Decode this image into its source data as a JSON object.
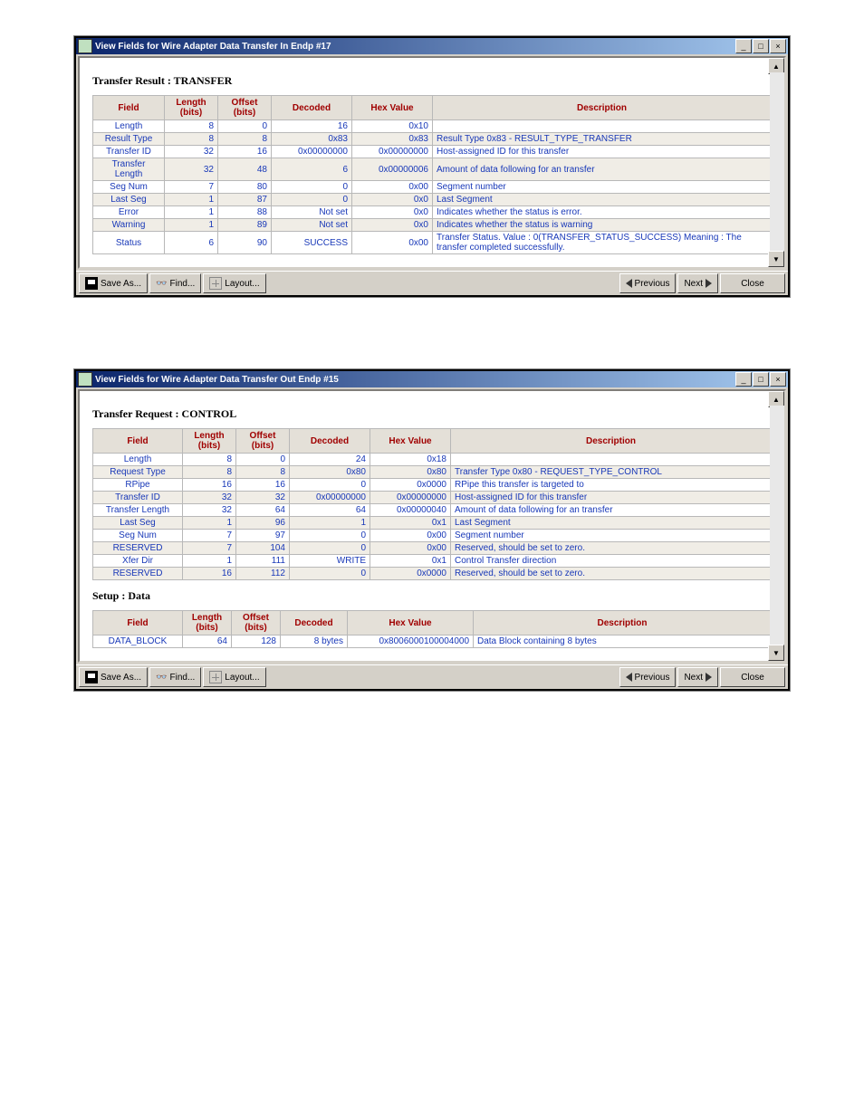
{
  "window1": {
    "title": "View Fields for Wire Adapter Data Transfer In Endp #17",
    "heading": "Transfer Result : TRANSFER",
    "columns": [
      "Field",
      "Length (bits)",
      "Offset (bits)",
      "Decoded",
      "Hex Value",
      "Description"
    ],
    "rows": [
      {
        "field": "Length",
        "length": "8",
        "offset": "0",
        "decoded": "16",
        "hex": "0x10",
        "desc": ""
      },
      {
        "field": "Result Type",
        "length": "8",
        "offset": "8",
        "decoded": "0x83",
        "hex": "0x83",
        "desc": "Result Type 0x83 - RESULT_TYPE_TRANSFER"
      },
      {
        "field": "Transfer ID",
        "length": "32",
        "offset": "16",
        "decoded": "0x00000000",
        "hex": "0x00000000",
        "desc": "Host-assigned ID for this transfer"
      },
      {
        "field": "Transfer Length",
        "length": "32",
        "offset": "48",
        "decoded": "6",
        "hex": "0x00000006",
        "desc": "Amount of data following for an transfer"
      },
      {
        "field": "Seg Num",
        "length": "7",
        "offset": "80",
        "decoded": "0",
        "hex": "0x00",
        "desc": "Segment number"
      },
      {
        "field": "Last Seg",
        "length": "1",
        "offset": "87",
        "decoded": "0",
        "hex": "0x0",
        "desc": "Last Segment"
      },
      {
        "field": "Error",
        "length": "1",
        "offset": "88",
        "decoded": "Not set",
        "hex": "0x0",
        "desc": "Indicates whether the status is error."
      },
      {
        "field": "Warning",
        "length": "1",
        "offset": "89",
        "decoded": "Not set",
        "hex": "0x0",
        "desc": "Indicates whether the status is warning"
      },
      {
        "field": "Status",
        "length": "6",
        "offset": "90",
        "decoded": "SUCCESS",
        "hex": "0x00",
        "desc": "Transfer Status. Value : 0(TRANSFER_STATUS_SUCCESS) Meaning : The transfer completed successfully."
      }
    ]
  },
  "window2": {
    "title": "View Fields for Wire Adapter Data Transfer Out Endp #15",
    "heading1": "Transfer Request : CONTROL",
    "columns1": [
      "Field",
      "Length (bits)",
      "Offset (bits)",
      "Decoded",
      "Hex Value",
      "Description"
    ],
    "rows1": [
      {
        "field": "Length",
        "length": "8",
        "offset": "0",
        "decoded": "24",
        "hex": "0x18",
        "desc": ""
      },
      {
        "field": "Request Type",
        "length": "8",
        "offset": "8",
        "decoded": "0x80",
        "hex": "0x80",
        "desc": "Transfer Type 0x80 - REQUEST_TYPE_CONTROL"
      },
      {
        "field": "RPipe",
        "length": "16",
        "offset": "16",
        "decoded": "0",
        "hex": "0x0000",
        "desc": "RPipe this transfer is targeted to"
      },
      {
        "field": "Transfer ID",
        "length": "32",
        "offset": "32",
        "decoded": "0x00000000",
        "hex": "0x00000000",
        "desc": "Host-assigned ID for this transfer"
      },
      {
        "field": "Transfer Length",
        "length": "32",
        "offset": "64",
        "decoded": "64",
        "hex": "0x00000040",
        "desc": "Amount of data following for an transfer"
      },
      {
        "field": "Last Seg",
        "length": "1",
        "offset": "96",
        "decoded": "1",
        "hex": "0x1",
        "desc": "Last Segment"
      },
      {
        "field": "Seg Num",
        "length": "7",
        "offset": "97",
        "decoded": "0",
        "hex": "0x00",
        "desc": "Segment number"
      },
      {
        "field": "RESERVED",
        "length": "7",
        "offset": "104",
        "decoded": "0",
        "hex": "0x00",
        "desc": "Reserved, should be set to zero."
      },
      {
        "field": "Xfer Dir",
        "length": "1",
        "offset": "111",
        "decoded": "WRITE",
        "hex": "0x1",
        "desc": "Control Transfer direction"
      },
      {
        "field": "RESERVED",
        "length": "16",
        "offset": "112",
        "decoded": "0",
        "hex": "0x0000",
        "desc": "Reserved, should be set to zero."
      }
    ],
    "heading2": "Setup : Data",
    "columns2": [
      "Field",
      "Length (bits)",
      "Offset (bits)",
      "Decoded",
      "Hex Value",
      "Description"
    ],
    "rows2": [
      {
        "field": "DATA_BLOCK",
        "length": "64",
        "offset": "128",
        "decoded": "8 bytes",
        "hex": "0x8006000100004000",
        "desc": "Data Block containing 8 bytes"
      }
    ]
  },
  "buttons": {
    "save": "Save As...",
    "find": "Find...",
    "layout": "Layout...",
    "previous": "Previous",
    "next": "Next",
    "close": "Close"
  }
}
